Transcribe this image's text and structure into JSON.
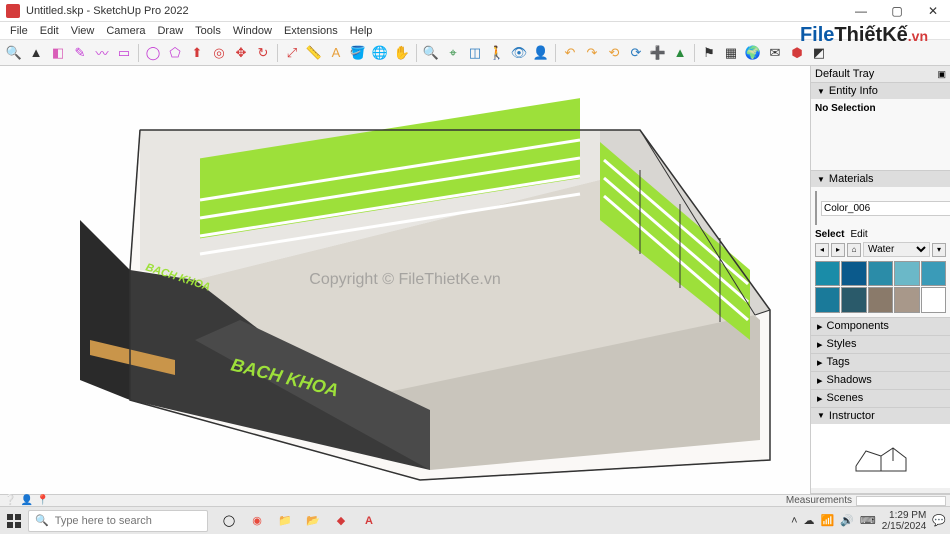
{
  "window": {
    "title": "Untitled.skp - SketchUp Pro 2022",
    "controls": {
      "min": "—",
      "max": "▢",
      "close": "✕"
    }
  },
  "menu": [
    "File",
    "Edit",
    "View",
    "Camera",
    "Draw",
    "Tools",
    "Window",
    "Extensions",
    "Help"
  ],
  "toolbar_icons": [
    {
      "name": "search-icon",
      "g": "🔍",
      "c": "#333"
    },
    {
      "name": "select-icon",
      "g": "▲",
      "c": "#333"
    },
    {
      "name": "eraser-icon",
      "g": "◧",
      "c": "#d95db8"
    },
    {
      "name": "pencil-icon",
      "g": "✎",
      "c": "#c43bd4"
    },
    {
      "name": "freehand-icon",
      "g": "〰",
      "c": "#c43bd4"
    },
    {
      "name": "rectangle-icon",
      "g": "▭",
      "c": "#c43bd4"
    },
    {
      "name": "circle-icon",
      "g": "◯",
      "c": "#c43bd4"
    },
    {
      "name": "polygon-icon",
      "g": "⬠",
      "c": "#c43bd4"
    },
    {
      "name": "pushpull-icon",
      "g": "⬆",
      "c": "#d43b3b"
    },
    {
      "name": "offset-icon",
      "g": "◎",
      "c": "#d43b3b"
    },
    {
      "name": "move-icon",
      "g": "✥",
      "c": "#d43b3b"
    },
    {
      "name": "rotate-icon",
      "g": "↻",
      "c": "#d43b3b"
    },
    {
      "name": "scale-icon",
      "g": "⤢",
      "c": "#d43b3b"
    },
    {
      "name": "tape-icon",
      "g": "📏",
      "c": "#e8a03c"
    },
    {
      "name": "text-icon",
      "g": "A",
      "c": "#e8a03c"
    },
    {
      "name": "paint-icon",
      "g": "🪣",
      "c": "#e8a03c"
    },
    {
      "name": "orbit-icon",
      "g": "🌐",
      "c": "#2b8c3e"
    },
    {
      "name": "pan-icon",
      "g": "✋",
      "c": "#2b8c3e"
    },
    {
      "name": "zoom-icon",
      "g": "🔍",
      "c": "#2b8c3e"
    },
    {
      "name": "zoom-extents-icon",
      "g": "⌖",
      "c": "#2b8c3e"
    },
    {
      "name": "section-icon",
      "g": "◫",
      "c": "#2b7bbf"
    },
    {
      "name": "walk-icon",
      "g": "🚶",
      "c": "#2b7bbf"
    },
    {
      "name": "position-icon",
      "g": "👁",
      "c": "#2b7bbf"
    },
    {
      "name": "person-icon",
      "g": "👤",
      "c": "#555"
    },
    {
      "name": "undo-icon",
      "g": "↶",
      "c": "#e8a03c"
    },
    {
      "name": "redo-icon",
      "g": "↷",
      "c": "#e8a03c"
    },
    {
      "name": "prev-icon",
      "g": "⟲",
      "c": "#e8a03c"
    },
    {
      "name": "refresh-icon",
      "g": "⟳",
      "c": "#2b7bbf"
    },
    {
      "name": "add-icon",
      "g": "➕",
      "c": "#2b7bbf"
    },
    {
      "name": "tree-icon",
      "g": "▲",
      "c": "#2b8c3e"
    },
    {
      "name": "flag-icon",
      "g": "⚑",
      "c": "#333"
    },
    {
      "name": "grid-icon",
      "g": "▦",
      "c": "#333"
    },
    {
      "name": "globe-icon",
      "g": "🌍",
      "c": "#2b8c3e"
    },
    {
      "name": "mail-icon",
      "g": "✉",
      "c": "#333"
    },
    {
      "name": "warehouse-icon",
      "g": "⬢",
      "c": "#d43b3b"
    },
    {
      "name": "component-icon",
      "g": "◩",
      "c": "#333"
    }
  ],
  "tray": {
    "title": "Default Tray",
    "entity_info": {
      "title": "Entity Info",
      "no_selection": "No Selection"
    },
    "materials": {
      "title": "Materials",
      "current": "Color_006",
      "select_tab": "Select",
      "edit_tab": "Edit",
      "dropdown": "Water",
      "swatches": [
        "#1a8ca8",
        "#0b5a8c",
        "#2b8ca8",
        "#6bb8c8",
        "#3a9bb8",
        "#1a7a9a",
        "#2a5a6a",
        "#8a7a6a",
        "#a8988a",
        "#ffffff"
      ]
    },
    "components": "Components",
    "styles": "Styles",
    "tags": "Tags",
    "shadows": "Shadows",
    "scenes": "Scenes",
    "instructor": "Instructor"
  },
  "statusbar": {
    "measurements_label": "Measurements"
  },
  "taskbar": {
    "search_placeholder": "Type here to search",
    "time": "1:29 PM",
    "date": "2/15/2024"
  },
  "scene_text": {
    "sign1": "BACH KHOA",
    "sign2": "BACH KHOA"
  },
  "watermark": {
    "logo_file": "File",
    "logo_thietke": "ThiếtKế",
    "logo_vn": ".vn",
    "center": "Copyright © FileThietKe.vn"
  }
}
